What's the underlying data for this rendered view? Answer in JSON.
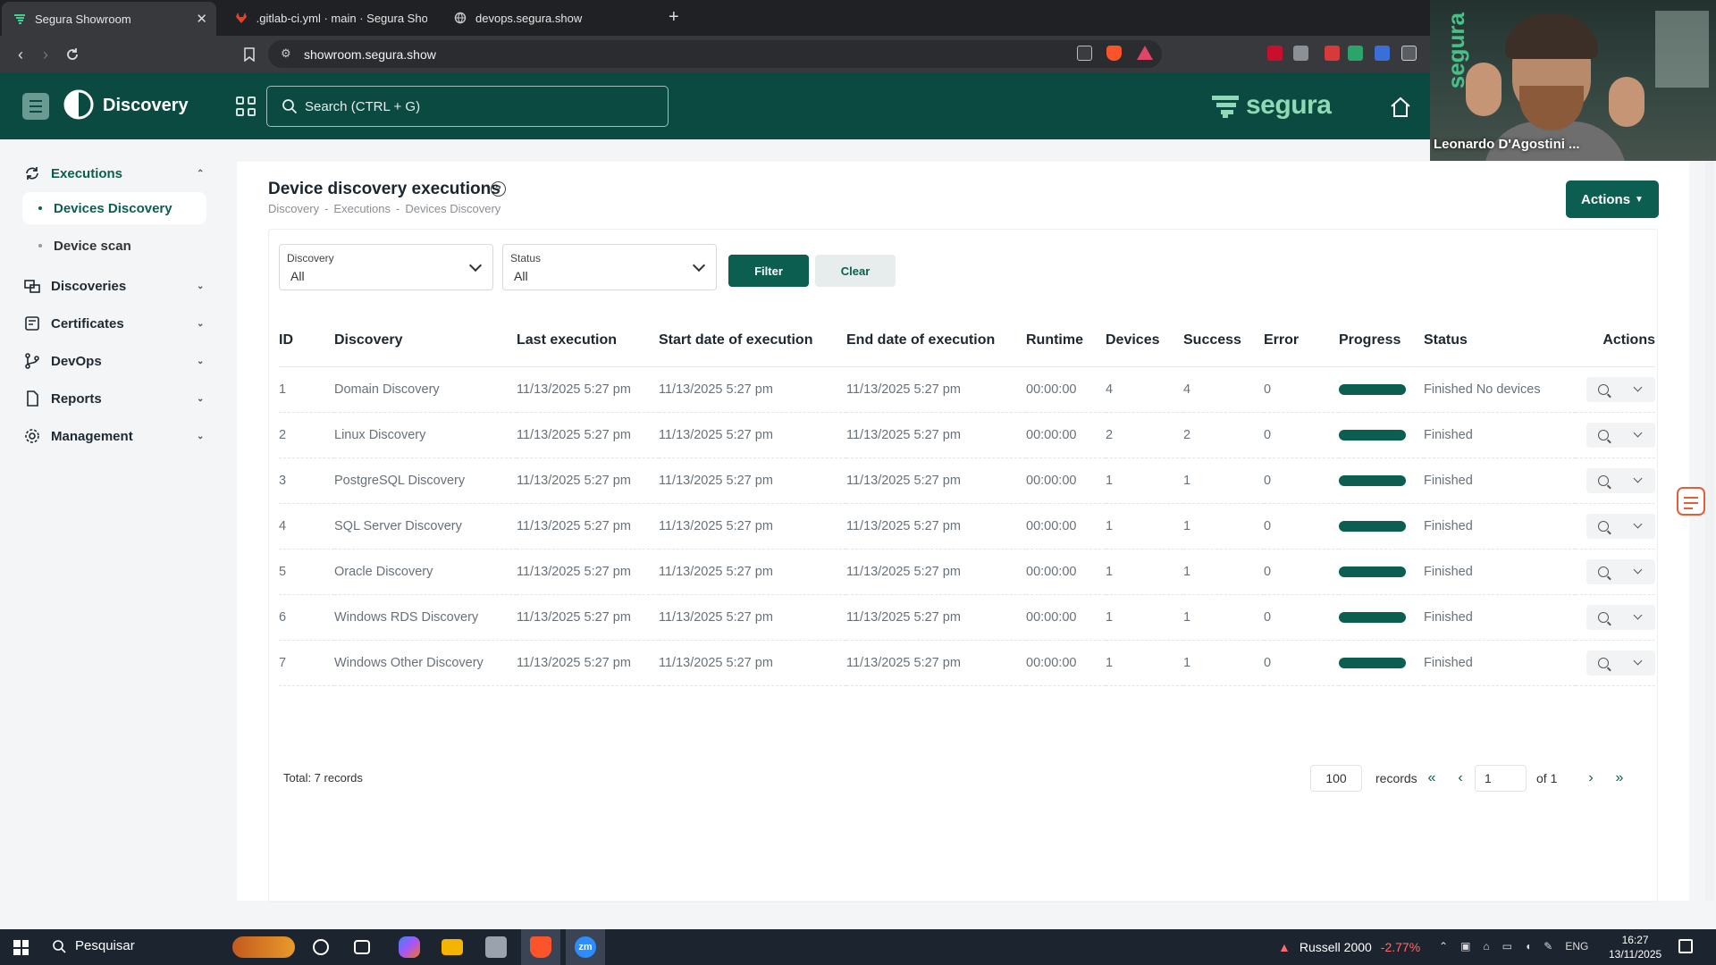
{
  "browser": {
    "tabs": [
      {
        "title": "Segura Showroom",
        "active": true
      },
      {
        "title": ".gitlab-ci.yml · main · Segura Showroo",
        "active": false
      },
      {
        "title": "devops.segura.show",
        "active": false
      }
    ],
    "url": "showroom.segura.show"
  },
  "header": {
    "app_title": "Discovery",
    "search_placeholder": "Search (CTRL + G)",
    "brand": "segura"
  },
  "video": {
    "participant": "Leonardo D'Agostini ...",
    "wall_text": "segura"
  },
  "sidebar": {
    "items": [
      {
        "label": "Executions",
        "expanded": true
      },
      {
        "label": "Discoveries"
      },
      {
        "label": "Certificates"
      },
      {
        "label": "DevOps"
      },
      {
        "label": "Reports"
      },
      {
        "label": "Management"
      }
    ],
    "sub_items": [
      {
        "label": "Devices Discovery",
        "active": true
      },
      {
        "label": "Device scan"
      }
    ]
  },
  "page": {
    "title": "Device discovery executions",
    "breadcrumb": [
      "Discovery",
      "-",
      "Executions",
      "-",
      "Devices Discovery"
    ],
    "actions_label": "Actions"
  },
  "filters": {
    "discovery": {
      "label": "Discovery",
      "value": "All"
    },
    "status": {
      "label": "Status",
      "value": "All"
    },
    "filter_label": "Filter",
    "clear_label": "Clear"
  },
  "table": {
    "columns": [
      "ID",
      "Discovery",
      "Last execution",
      "Start date of execution",
      "End date of execution",
      "Runtime",
      "Devices",
      "Success",
      "Error",
      "Progress",
      "Status",
      "Actions"
    ],
    "rows": [
      {
        "id": "1",
        "discovery": "Domain Discovery",
        "last": "11/13/2025 5:27 pm",
        "start": "11/13/2025 5:27 pm",
        "end": "11/13/2025 5:27 pm",
        "runtime": "00:00:00",
        "devices": "4",
        "success": "4",
        "error": "0",
        "progress": 1.0,
        "status": "Finished No devices"
      },
      {
        "id": "2",
        "discovery": "Linux Discovery",
        "last": "11/13/2025 5:27 pm",
        "start": "11/13/2025 5:27 pm",
        "end": "11/13/2025 5:27 pm",
        "runtime": "00:00:00",
        "devices": "2",
        "success": "2",
        "error": "0",
        "progress": 1.0,
        "status": "Finished"
      },
      {
        "id": "3",
        "discovery": "PostgreSQL Discovery",
        "last": "11/13/2025 5:27 pm",
        "start": "11/13/2025 5:27 pm",
        "end": "11/13/2025 5:27 pm",
        "runtime": "00:00:00",
        "devices": "1",
        "success": "1",
        "error": "0",
        "progress": 1.0,
        "status": "Finished"
      },
      {
        "id": "4",
        "discovery": "SQL Server Discovery",
        "last": "11/13/2025 5:27 pm",
        "start": "11/13/2025 5:27 pm",
        "end": "11/13/2025 5:27 pm",
        "runtime": "00:00:00",
        "devices": "1",
        "success": "1",
        "error": "0",
        "progress": 1.0,
        "status": "Finished"
      },
      {
        "id": "5",
        "discovery": "Oracle Discovery",
        "last": "11/13/2025 5:27 pm",
        "start": "11/13/2025 5:27 pm",
        "end": "11/13/2025 5:27 pm",
        "runtime": "00:00:00",
        "devices": "1",
        "success": "1",
        "error": "0",
        "progress": 1.0,
        "status": "Finished"
      },
      {
        "id": "6",
        "discovery": "Windows RDS Discovery",
        "last": "11/13/2025 5:27 pm",
        "start": "11/13/2025 5:27 pm",
        "end": "11/13/2025 5:27 pm",
        "runtime": "00:00:00",
        "devices": "1",
        "success": "1",
        "error": "0",
        "progress": 1.0,
        "status": "Finished"
      },
      {
        "id": "7",
        "discovery": "Windows Other Discovery",
        "last": "11/13/2025 5:27 pm",
        "start": "11/13/2025 5:27 pm",
        "end": "11/13/2025 5:27 pm",
        "runtime": "00:00:00",
        "devices": "1",
        "success": "1",
        "error": "0",
        "progress": 1.0,
        "status": "Finished"
      }
    ]
  },
  "footer": {
    "total": "Total: 7 records",
    "page_size": "100",
    "records_label": "records",
    "page": "1",
    "of_label": "of 1"
  },
  "taskbar": {
    "search_label": "Pesquisar",
    "ticker_name": "Russell 2000",
    "ticker_change": "-2.77%",
    "lang": "ENG",
    "time": "16:27",
    "date": "13/11/2025"
  },
  "colors": {
    "brand_dark": "#0b4a40",
    "accent": "#0b5e50",
    "brand_light": "#8fd9b5"
  }
}
